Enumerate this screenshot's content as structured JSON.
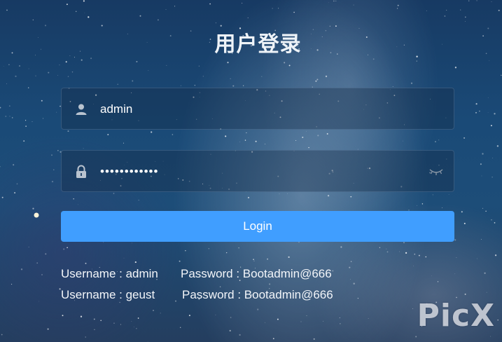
{
  "page": {
    "title": "用户登录",
    "watermark": "PicX"
  },
  "form": {
    "username": {
      "value": "admin",
      "icon": "user-icon"
    },
    "password": {
      "value": "Bootadmin@66",
      "icon": "lock-icon",
      "toggle_icon": "eye-closed-icon"
    },
    "login_label": "Login"
  },
  "hints": [
    {
      "username": "Username : admin",
      "password": "Password : Bootadmin@666"
    },
    {
      "username": "Username : geust",
      "password": "Password : Bootadmin@666"
    }
  ],
  "colors": {
    "button": "#409eff",
    "background": "#1d4d78"
  }
}
